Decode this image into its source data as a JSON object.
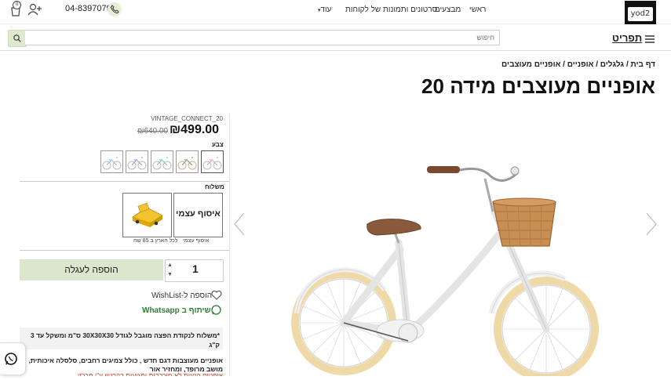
{
  "header": {
    "phone": "04-8397079",
    "cart_count": "0",
    "logo_text": "yod2",
    "nav": {
      "home": "ראשי",
      "deals": "מבצעים",
      "videos": "סרטונים ותמונות של לקוחות",
      "more": "עוד"
    }
  },
  "search": {
    "placeholder": "חיפוש",
    "menu_label": "תפריט"
  },
  "breadcrumb": "דף בית / גלגלים / אופניים / אופניים מעוצבים",
  "product": {
    "title": "אופניים מעוצבים מידה 20",
    "sku": "VINTAGE_CONNECT_20",
    "price_new": "₪499.00",
    "price_old": "₪640.00",
    "color_label": "צבע",
    "shipping_label": "משלוח",
    "pickup_title": "איסוף עצמי",
    "pickup_sub": "איסוף עצמי",
    "delivery_sub": "לכל הארץ ב 85 שח",
    "quantity": "1",
    "add_to_cart": "הוספה לעגלה",
    "wishlist": "הוספה ל-WishList",
    "share": "שיתוף ב Whatsapp",
    "shipping_note": "*משלוח לנקודת הפצה מוגבל לגודל 30X30X30 ס\"מ ומשקל עד 3 ק\"ג",
    "description": "אופניים מעוצבות דגם חדש , כולל צמיגים רחבים, סלסלה איכותית, מושב מרופד, ומחזיר אור",
    "description_red": "אופניים הנעות לא מורכבות ומגיעות בקרטון ע\"י מרכזי"
  },
  "colors": {
    "accent": "#dbe6cd",
    "whatsapp": "#2e7d32"
  }
}
